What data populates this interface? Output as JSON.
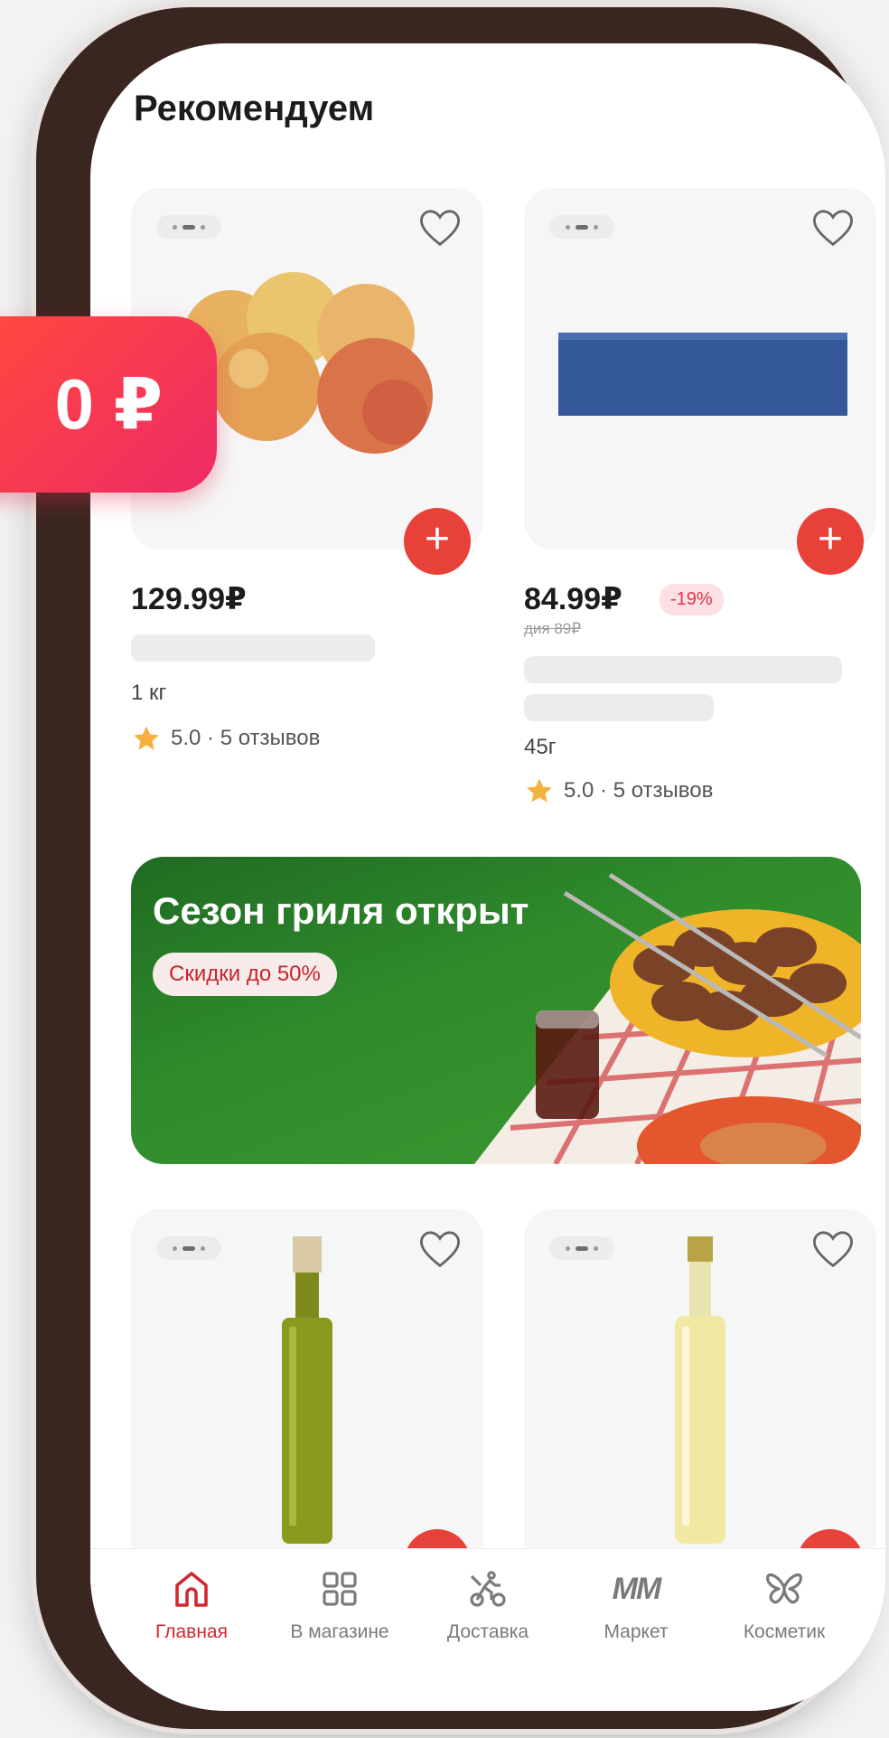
{
  "section": {
    "title": "Рекомендуем"
  },
  "promo_badge": {
    "text": "0 ₽"
  },
  "products": [
    {
      "price": "129.99₽",
      "weight": "1 кг",
      "rating": "5.0 · 5 отзывов"
    },
    {
      "price": "84.99₽",
      "discount": "-19%",
      "old_price": "дия 89₽",
      "weight": "45г",
      "rating": "5.0 · 5 отзывов"
    },
    {},
    {}
  ],
  "banner": {
    "title": "Сезон гриля открыт",
    "pill": "Скидки до 50%"
  },
  "nav": {
    "items": [
      {
        "label": "Главная",
        "icon": "home-icon",
        "active": true
      },
      {
        "label": "В магазине",
        "icon": "grid-icon",
        "active": false
      },
      {
        "label": "Доставка",
        "icon": "delivery-icon",
        "active": false
      },
      {
        "label": "Маркет",
        "icon": "market-icon",
        "logo": "ММ",
        "active": false
      },
      {
        "label": "Косметик",
        "icon": "butterfly-icon",
        "active": false
      }
    ]
  },
  "colors": {
    "accent": "#e8413a",
    "active_nav": "#d0282f",
    "discount_bg": "#fde0e3",
    "frame": "#3a2621"
  }
}
